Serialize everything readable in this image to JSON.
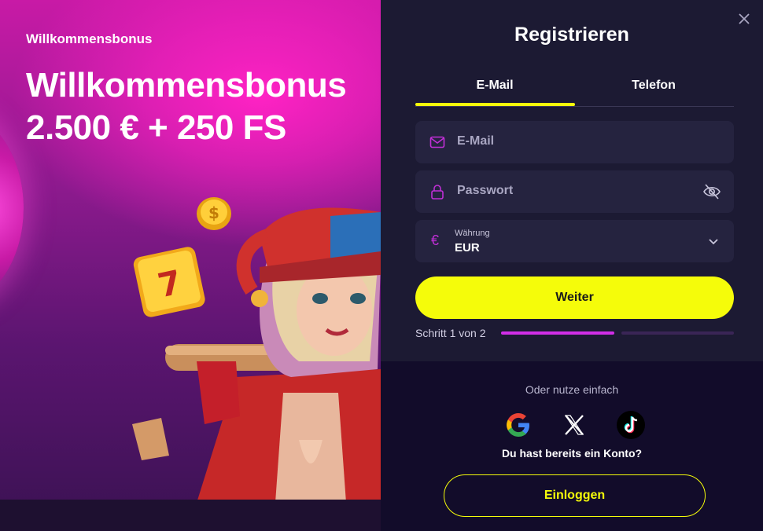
{
  "promo": {
    "kicker": "Willkommensbonus",
    "headline_line1": "Willkommensbonus",
    "headline_line2": "2.500 € + 250 FS"
  },
  "register": {
    "title": "Registrieren",
    "tabs": [
      {
        "label": "E-Mail",
        "active": true
      },
      {
        "label": "Telefon",
        "active": false
      }
    ],
    "email_placeholder": "E-Mail",
    "password_placeholder": "Passwort",
    "currency": {
      "label": "Währung",
      "value": "EUR",
      "symbol": "€"
    },
    "continue_label": "Weiter",
    "step_text": "Schritt 1 von 2",
    "step": {
      "current": 1,
      "total": 2
    },
    "alt_text": "Oder nutze einfach",
    "social": [
      "google-icon",
      "x-icon",
      "tiktok-icon"
    ],
    "have_account": "Du hast bereits ein Konto?",
    "login_label": "Einloggen"
  },
  "colors": {
    "accent": "#f5fc0a",
    "brand_magenta": "#d12ee8",
    "panel_bg": "#1c1a33",
    "field_bg": "#25233f"
  }
}
